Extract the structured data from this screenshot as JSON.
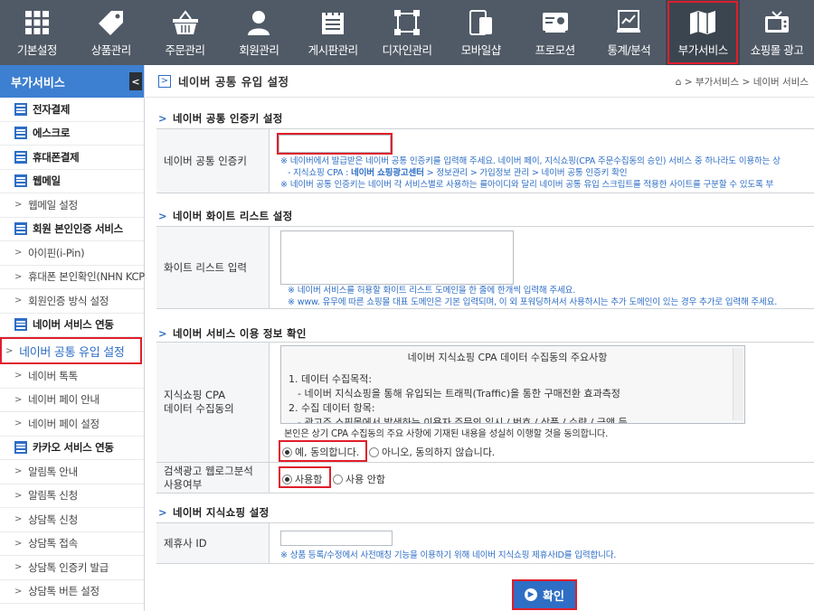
{
  "topnav": [
    {
      "label": "기본설정",
      "icon": "grid-icon"
    },
    {
      "label": "상품관리",
      "icon": "tag-icon"
    },
    {
      "label": "주문관리",
      "icon": "basket-icon"
    },
    {
      "label": "회원관리",
      "icon": "person-icon"
    },
    {
      "label": "게시판관리",
      "icon": "board-icon"
    },
    {
      "label": "디자인관리",
      "icon": "frame-icon"
    },
    {
      "label": "모바일샵",
      "icon": "mobile-icon"
    },
    {
      "label": "프로모션",
      "icon": "card-icon"
    },
    {
      "label": "통계/분석",
      "icon": "chart-icon"
    },
    {
      "label": "부가서비스",
      "icon": "map-icon",
      "selected": true
    },
    {
      "label": "쇼핑몰 광고",
      "icon": "tv-icon"
    }
  ],
  "sidebar": {
    "title": "부가서비스",
    "toggle": "<",
    "items": [
      {
        "label": "전자결제",
        "type": "group"
      },
      {
        "label": "에스크로",
        "type": "group"
      },
      {
        "label": "휴대폰결제",
        "type": "group"
      },
      {
        "label": "웹메일",
        "type": "group"
      },
      {
        "label": "웹메일 설정",
        "type": "sub"
      },
      {
        "label": "회원 본인인증 서비스",
        "type": "group"
      },
      {
        "label": "아이핀(i-Pin)",
        "type": "sub"
      },
      {
        "label": "휴대폰 본인확인(NHN KCP)",
        "type": "sub"
      },
      {
        "label": "회원인증 방식 설정",
        "type": "sub"
      },
      {
        "label": "네이버 서비스 연동",
        "type": "group"
      },
      {
        "label": "네이버 공통 유입 설정",
        "type": "sub",
        "active": true
      },
      {
        "label": "네이버 톡톡",
        "type": "sub"
      },
      {
        "label": "네이버 페이 안내",
        "type": "sub"
      },
      {
        "label": "네이버 페이 설정",
        "type": "sub"
      },
      {
        "label": "카카오 서비스 연동",
        "type": "group"
      },
      {
        "label": "알림톡 안내",
        "type": "sub"
      },
      {
        "label": "알림톡 신청",
        "type": "sub"
      },
      {
        "label": "상담톡 신청",
        "type": "sub"
      },
      {
        "label": "상담톡 접속",
        "type": "sub"
      },
      {
        "label": "상담톡 인증키 발급",
        "type": "sub"
      },
      {
        "label": "상담톡 버튼 설정",
        "type": "sub"
      }
    ]
  },
  "page": {
    "title": "네이버 공통 유입 설정",
    "breadcrumb": "⌂ > 부가서비스 > 네이버 서비스"
  },
  "sections": {
    "auth": {
      "title": "네이버 공통 인증키 설정",
      "label": "네이버 공통 인증키",
      "value": "",
      "note1": "※ 네이버에서 발급받은 네이버 공통 인증키를 입력해 주세요. 네이버 페이, 지식쇼핑(CPA 주문수집동의 승인) 서비스 중 하나라도 이용하는 상",
      "note2_pre": "- 지식쇼핑 CPA : ",
      "note2_bold": "네이버 쇼핑광고센터",
      "note2_post": " > 정보관리 > 가입정보 관리 > 네이버 공통 인증키 확인",
      "note3": "※ 네이버 공통 인증키는 네이버 각 서비스별로 사용하는 를아이디와 달리 네이버 공통 유입 스크립트를 적용한 사이트를 구분할 수 있도록 부"
    },
    "whitelist": {
      "title": "네이버 화이트 리스트 설정",
      "label": "화이트 리스트 입력",
      "value": "",
      "note1": "※ 네이버 서비스를 허용할 화이트 리스트 도메인을 한 줄에 한개씩 입력해 주세요.",
      "note2": "※ www. 유무에 따른 쇼핑몰 대표 도메인은 기본 입력되며, 이 외 포워딩하셔서 사용하시는 추가 도메인이 있는 경우 추가로 입력해 주세요."
    },
    "info": {
      "title": "네이버 서비스 이용 정보 확인",
      "label_line1": "지식쇼핑 CPA",
      "label_line2": "데이터 수집동의",
      "box_title": "네이버 지식쇼핑 CPA 데이터 수집동의 주요사항",
      "box_l1": "1. 데이터 수집목적:",
      "box_l2": "- 네이버 지식쇼핑을 통해 유입되는 트래픽(Traffic)을 통한 구매전환 효과측정",
      "box_l3": "2. 수집 데이터 항목:",
      "box_l4": "- 광고주 쇼핑몰에서 발생하는 이용자 주문의 일시 / 번호 / 상품 / 수량 / 금액 등",
      "consent": "본인은 상기 CPA 수집동의 주요 사항에 기재된 내용을 성실히 이행할 것을 동의합니다.",
      "agree": "예, 동의합니다.",
      "disagree": "아니오, 동의하지 않습니다.",
      "label2_line1": "검색광고 웹로그분석",
      "label2_line2": "사용여부",
      "use": "사용함",
      "nouse": "사용 안함"
    },
    "shopping": {
      "title": "네이버 지식쇼핑 설정",
      "label": "제휴사 ID",
      "value": "",
      "note": "※ 상품 등록/수정에서 사전매칭 기능을 이용하기 위해 네이버 지식쇼핑 제휴사ID를 입력합니다."
    }
  },
  "confirm_button": "확인",
  "colors": {
    "nav": "#505a66",
    "accent": "#2e6ec5",
    "highlight": "#e01e2b"
  }
}
